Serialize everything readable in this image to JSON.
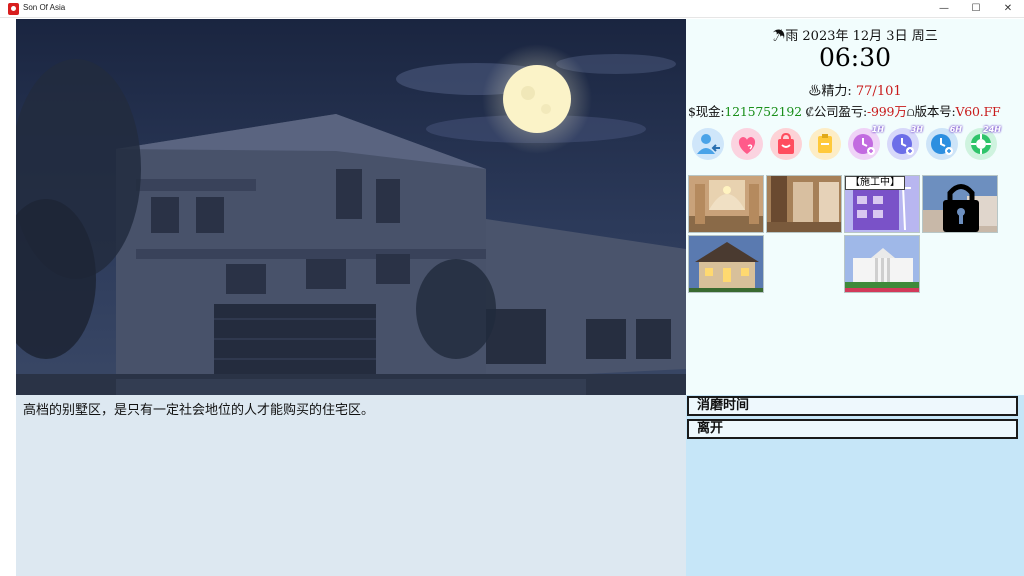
{
  "window": {
    "title": "Son Of Asia",
    "minimize": "—",
    "maximize": "☐",
    "close": "✕"
  },
  "status": {
    "weather_icon": "☂",
    "weather_line": "雨 2023年 12月 3日 周三",
    "time": "06:30",
    "energy_icon": "♨",
    "energy_label": "精力: ",
    "energy_value": "77/101",
    "cash_label": "$现金:",
    "cash_value": "1215752192",
    "company_label": " ₡公司盈亏:",
    "company_value": "-999万",
    "version_label": "⩍版本号:",
    "version_value": "V60.FF"
  },
  "toolbar": {
    "items": [
      {
        "name": "contacts-icon",
        "color": "#4aa3e8"
      },
      {
        "name": "heart-icon",
        "color": "#ff5a8a"
      },
      {
        "name": "shopping-bag-icon",
        "color": "#ff4d5e"
      },
      {
        "name": "notes-icon",
        "color": "#ffc93a"
      },
      {
        "name": "clock-1h-icon",
        "color": "#c26be0",
        "badge": "1H"
      },
      {
        "name": "clock-3h-icon",
        "color": "#6c6ee8",
        "badge": "3H"
      },
      {
        "name": "clock-6h-icon",
        "color": "#2c8fe0",
        "badge": "6H"
      },
      {
        "name": "clock-24h-icon",
        "color": "#2fc46a",
        "badge": "24H"
      }
    ]
  },
  "locations": {
    "construction_label": "【施工中】"
  },
  "description": "高档的别墅区，是只有一定社会地位的人才能购买的住宅区。",
  "actions": {
    "pass_time": "消磨时间",
    "leave": "离开"
  }
}
